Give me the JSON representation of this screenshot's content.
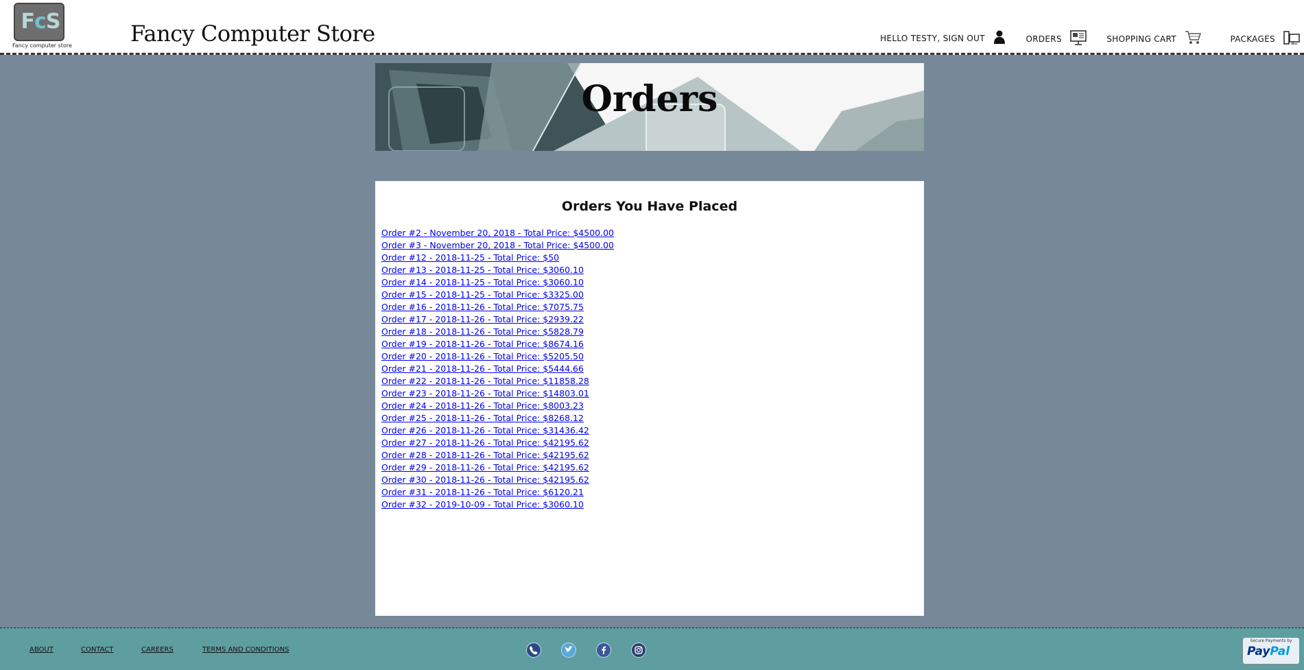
{
  "header": {
    "logo_caption": "Fancy computer store",
    "title": "Fancy Computer Store",
    "nav": [
      {
        "label": "Hello Testy, Sign Out",
        "icon": "user-icon"
      },
      {
        "label": "Orders",
        "icon": "orders-icon"
      },
      {
        "label": "Shopping Cart",
        "icon": "cart-icon"
      },
      {
        "label": "Packages",
        "icon": "packages-icon"
      }
    ]
  },
  "banner": {
    "title": "Orders"
  },
  "main": {
    "heading": "Orders You Have Placed",
    "orders": [
      "Order #2 - November 20, 2018 - Total Price: $4500.00",
      "Order #3 - November 20, 2018 - Total Price: $4500.00",
      "Order #12 - 2018-11-25 - Total Price: $50",
      "Order #13 - 2018-11-25 - Total Price: $3060.10",
      "Order #14 - 2018-11-25 - Total Price: $3060.10",
      "Order #15 - 2018-11-25 - Total Price: $3325.00",
      "Order #16 - 2018-11-26 - Total Price: $7075.75",
      "Order #17 - 2018-11-26 - Total Price: $2939.22",
      "Order #18 - 2018-11-26 - Total Price: $5828.79",
      "Order #19 - 2018-11-26 - Total Price: $8674.16",
      "Order #20 - 2018-11-26 - Total Price: $5205.50",
      "Order #21 - 2018-11-26 - Total Price: $5444.66",
      "Order #22 - 2018-11-26 - Total Price: $11858.28",
      "Order #23 - 2018-11-26 - Total Price: $14803.01",
      "Order #24 - 2018-11-26 - Total Price: $8003.23",
      "Order #25 - 2018-11-26 - Total Price: $8268.12",
      "Order #26 - 2018-11-26 - Total Price: $31436.42",
      "Order #27 - 2018-11-26 - Total Price: $42195.62",
      "Order #28 - 2018-11-26 - Total Price: $42195.62",
      "Order #29 - 2018-11-26 - Total Price: $42195.62",
      "Order #30 - 2018-11-26 - Total Price: $42195.62",
      "Order #31 - 2018-11-26 - Total Price: $6120.21",
      "Order #32 - 2019-10-09 - Total Price: $3060.10"
    ]
  },
  "footer": {
    "links": [
      "About",
      "Contact",
      "Careers",
      "Terms and Conditions"
    ],
    "social": [
      "phone-icon",
      "twitter-icon",
      "facebook-icon",
      "instagram-icon"
    ],
    "paypal_caption": "Secure Payments by",
    "paypal_label_1": "Pay",
    "paypal_label_2": "Pal"
  },
  "colors": {
    "page_bg": "#778899",
    "footer_bg": "#5f9ea0",
    "link": "#0000ee"
  }
}
